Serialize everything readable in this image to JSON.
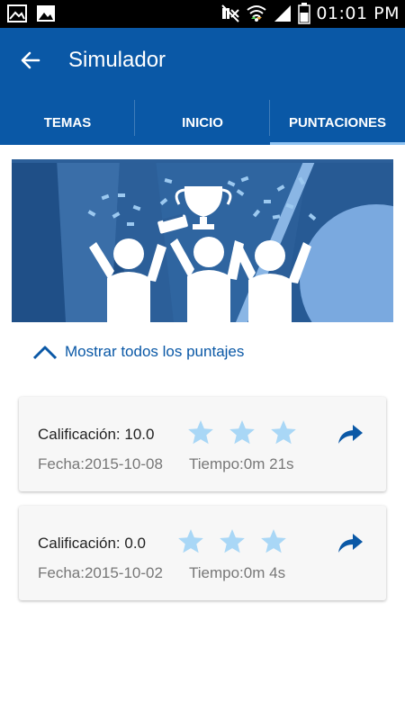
{
  "status_bar": {
    "time": "01:01 PM",
    "icons": [
      "picture-icon",
      "gallery-icon",
      "mute-icon",
      "wifi-icon",
      "signal-icon",
      "battery-icon"
    ]
  },
  "app_bar": {
    "title": "Simulador",
    "back_icon": "arrow-left-icon",
    "color": "#0a58a6"
  },
  "tabs": [
    {
      "label": "TEMAS",
      "active": false
    },
    {
      "label": "INICIO",
      "active": false
    },
    {
      "label": "PUNTACIONES",
      "active": true
    }
  ],
  "show_all": {
    "label": "Mostrar todos los puntajes",
    "icon": "chevron-up-icon"
  },
  "scores": [
    {
      "grade": "Calificación: 10.0",
      "date": "Fecha:2015-10-08",
      "time": "Tiempo:0m 21s",
      "stars": 3
    },
    {
      "grade": "Calificación: 0.0",
      "date": "Fecha:2015-10-02",
      "time": "Tiempo:0m 4s",
      "stars": 3
    }
  ],
  "colors": {
    "primary": "#0a58a6",
    "star": "#a9d7f6",
    "tab_indicator": "#8fc3f2"
  }
}
